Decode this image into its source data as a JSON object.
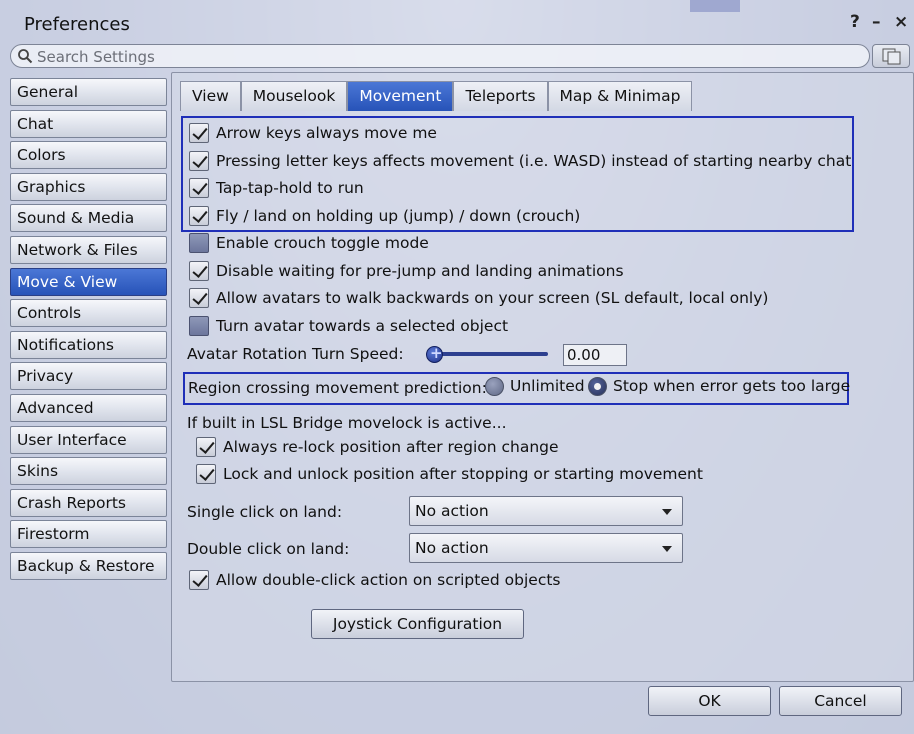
{
  "window": {
    "title": "Preferences",
    "help_label": "?",
    "minimize_label": "–",
    "close_label": "×"
  },
  "search": {
    "placeholder": "Search Settings",
    "value": ""
  },
  "sidebar": {
    "items": [
      {
        "label": "General"
      },
      {
        "label": "Chat"
      },
      {
        "label": "Colors"
      },
      {
        "label": "Graphics"
      },
      {
        "label": "Sound & Media"
      },
      {
        "label": "Network & Files"
      },
      {
        "label": "Move & View",
        "selected": true
      },
      {
        "label": "Controls"
      },
      {
        "label": "Notifications"
      },
      {
        "label": "Privacy"
      },
      {
        "label": "Advanced"
      },
      {
        "label": "User Interface"
      },
      {
        "label": "Skins"
      },
      {
        "label": "Crash Reports"
      },
      {
        "label": "Firestorm"
      },
      {
        "label": "Backup & Restore"
      }
    ]
  },
  "tabs": [
    {
      "label": "View"
    },
    {
      "label": "Mouselook"
    },
    {
      "label": "Movement",
      "selected": true
    },
    {
      "label": "Teleports"
    },
    {
      "label": "Map & Minimap"
    }
  ],
  "movement": {
    "checkboxes": [
      {
        "label": "Arrow keys always move me",
        "checked": true
      },
      {
        "label": "Pressing letter keys affects movement (i.e. WASD) instead of starting nearby chat",
        "checked": true
      },
      {
        "label": "Tap-tap-hold to run",
        "checked": true
      },
      {
        "label": "Fly / land on holding up (jump) / down (crouch)",
        "checked": true
      },
      {
        "label": "Enable crouch toggle mode",
        "checked": false
      },
      {
        "label": "Disable waiting for pre-jump and landing animations",
        "checked": true
      },
      {
        "label": "Allow avatars to walk backwards on your screen (SL default, local only)",
        "checked": true
      },
      {
        "label": "Turn avatar towards a selected object",
        "checked": false
      }
    ],
    "turn_speed_label": "Avatar Rotation Turn Speed:",
    "turn_speed_value": "0.00",
    "turn_speed_fraction": 0.0,
    "region_crossing": {
      "label": "Region crossing movement prediction:",
      "options": [
        {
          "label": "Unlimited",
          "selected": false
        },
        {
          "label": "Stop when error gets too large",
          "selected": true
        }
      ]
    },
    "lsl_bridge_label": "If built in LSL Bridge movelock is active...",
    "lsl_checkboxes": [
      {
        "label": "Always re-lock position after region change",
        "checked": true
      },
      {
        "label": "Lock and unlock position after stopping or starting movement",
        "checked": true
      }
    ],
    "single_click_label": "Single click on land:",
    "single_click_value": "No action",
    "double_click_label": "Double click on land:",
    "double_click_value": "No action",
    "double_click_scripted": {
      "label": "Allow double-click action on scripted objects",
      "checked": true
    },
    "joystick_button": "Joystick Configuration"
  },
  "footer": {
    "ok_label": "OK",
    "cancel_label": "Cancel"
  },
  "colors": {
    "accent": "#2753b8",
    "highlight_border": "#1f2fb8"
  }
}
